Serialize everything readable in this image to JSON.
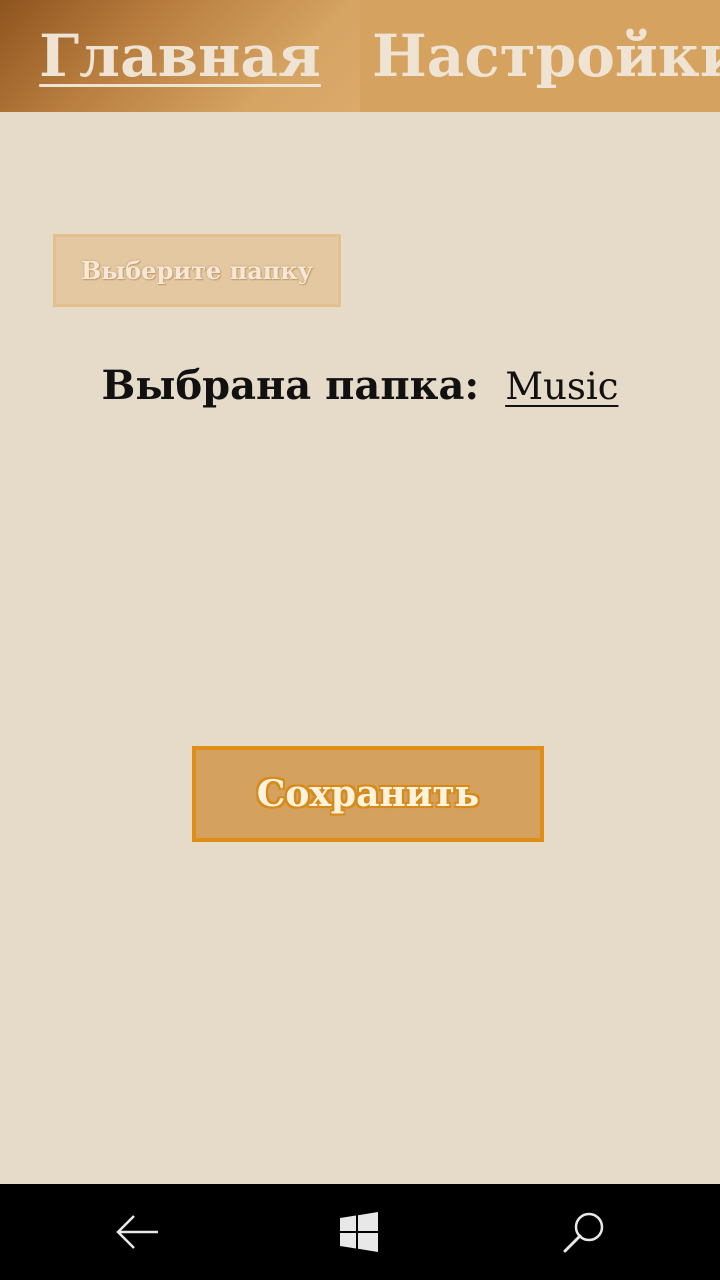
{
  "tabs": [
    {
      "label": "Главная",
      "active": true
    },
    {
      "label": "Настройки",
      "active": false
    }
  ],
  "folder_picker": {
    "button_label": "Выберите папку",
    "selected_label": "Выбрана папка:",
    "selected_value": "Music"
  },
  "save_button": {
    "label": "Сохранить"
  },
  "system_nav": {
    "back_icon": "back-arrow",
    "home_icon": "windows-logo",
    "search_icon": "search-magnifier"
  },
  "colors": {
    "background": "#e6dac9",
    "tab_accent": "#d5a260",
    "save_border": "#df8e16",
    "navbar": "#000000"
  }
}
